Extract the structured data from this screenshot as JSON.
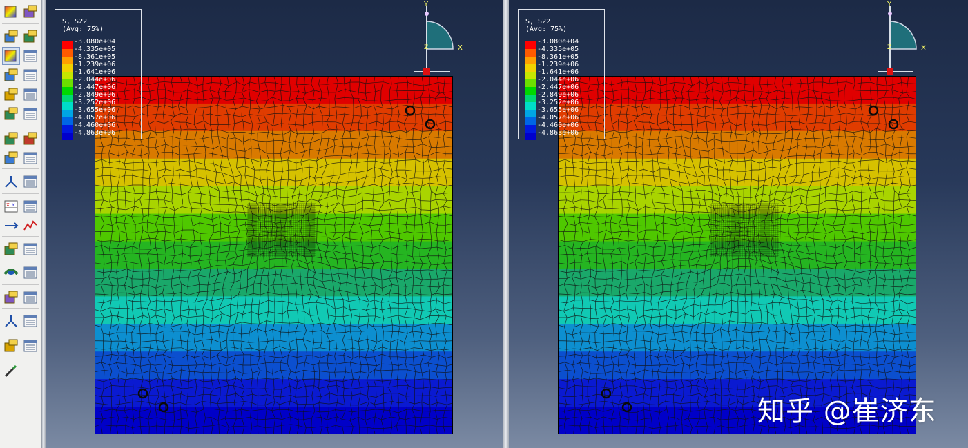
{
  "toolbox": {
    "rows": [
      [
        "result-contour-icon",
        "deformed-shape-icon"
      ],
      [
        "undeformed-shape-icon",
        "deformed-plot-icon"
      ],
      [
        "contour-plot-icon",
        "contour-options-icon"
      ],
      [
        "symbol-plot-icon",
        "symbol-options-icon"
      ],
      [
        "material-orientation-icon",
        "orientation-options-icon"
      ],
      [
        "plot-multiple-icon",
        "overlay-options-icon"
      ],
      [
        "animate-scale-icon",
        "animate-time-icon"
      ],
      [
        "animate-harmonic-icon",
        "animation-options-icon"
      ],
      [
        "view-cut-icon",
        "view-cut-manager-icon"
      ],
      [
        "xy-data-icon",
        "xy-data-manager-icon"
      ],
      [
        "create-path-icon",
        "xy-plot-icon"
      ],
      [
        "display-group-icon",
        "display-group-manager-icon"
      ],
      [
        "stream-plot-icon",
        "stream-manager-icon"
      ],
      [
        "free-body-icon",
        "free-body-manager-icon"
      ],
      [
        "view-cut-surface-icon",
        "surface-manager-icon"
      ],
      [
        "query-icon",
        "query-manager-icon"
      ],
      [
        "query-tool-icon"
      ]
    ]
  },
  "viewports": [
    {
      "legend": {
        "title": "S, S22",
        "subtitle": "(Avg: 75%)",
        "levels": [
          "-3.080e+04",
          "-4.335e+05",
          "-8.361e+05",
          "-1.239e+06",
          "-1.641e+06",
          "-2.044e+06",
          "-2.447e+06",
          "-2.849e+06",
          "-3.252e+06",
          "-3.655e+06",
          "-4.057e+06",
          "-4.460e+06",
          "-4.863e+06"
        ],
        "colors": [
          "#ff0000",
          "#ff5a00",
          "#ffa000",
          "#f2d200",
          "#c6e600",
          "#6cdf00",
          "#00d800",
          "#00d873",
          "#00dcc8",
          "#00a6e5",
          "#0066e6",
          "#0019e0",
          "#0000cc"
        ]
      },
      "triad": {
        "y": "Y",
        "x": "X",
        "z": "Z"
      }
    },
    {
      "legend": {
        "title": "S, S22",
        "subtitle": "(Avg: 75%)",
        "levels": [
          "-3.080e+04",
          "-4.335e+05",
          "-8.361e+05",
          "-1.239e+06",
          "-1.641e+06",
          "-2.044e+06",
          "-2.447e+06",
          "-2.849e+06",
          "-3.252e+06",
          "-3.655e+06",
          "-4.057e+06",
          "-4.460e+06",
          "-4.863e+06"
        ],
        "colors": [
          "#ff0000",
          "#ff5a00",
          "#ffa000",
          "#f2d200",
          "#c6e600",
          "#6cdf00",
          "#00d800",
          "#00d873",
          "#00dcc8",
          "#00a6e5",
          "#0066e6",
          "#0019e0",
          "#0000cc"
        ]
      },
      "triad": {
        "y": "Y",
        "x": "X",
        "z": "Z"
      }
    }
  ],
  "mesh_bands": [
    "#e00000",
    "#e03c00",
    "#d97a00",
    "#d6c100",
    "#a9d400",
    "#4fc800",
    "#25b521",
    "#1aa86a",
    "#11c9b4",
    "#0d8fd0",
    "#0b4fcf",
    "#0a1ad1",
    "#0000c8"
  ],
  "watermark": "知乎 @崔济东"
}
